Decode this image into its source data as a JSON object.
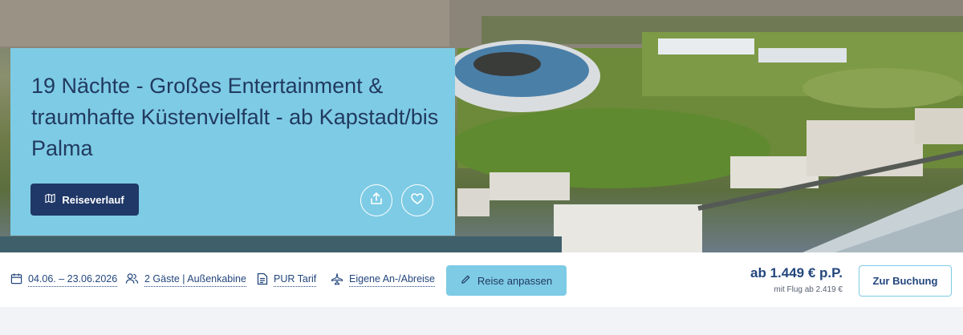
{
  "hero": {
    "title": "19 Nächte - Großes Entertainment & traumhafte Küstenvielfalt - ab Kapstadt/bis Palma",
    "route_button": "Reiseverlauf",
    "share_icon": "share-icon",
    "like_icon": "heart-icon"
  },
  "info": {
    "dates": "04.06. – 23.06.2026",
    "guests": "2 Gäste | Außenkabine",
    "tariff": "PUR Tarif",
    "travel": "Eigene An-/Abreise",
    "adjust_button": "Reise anpassen",
    "price_main": "ab 1.449 € p.P.",
    "price_sub": "mit Flug ab 2.419 €",
    "book_button": "Zur Buchung"
  },
  "colors": {
    "card": "#7ecbe5",
    "primary": "#1f3867",
    "text": "#23467d",
    "background": "#f1f3f7"
  }
}
